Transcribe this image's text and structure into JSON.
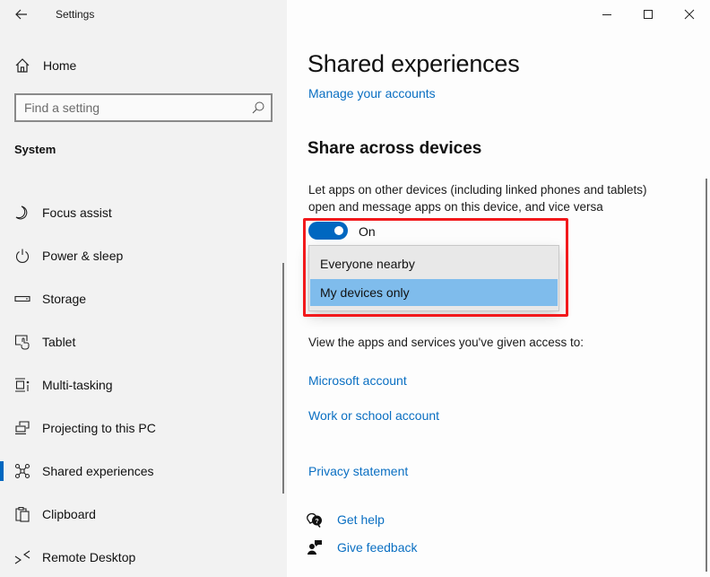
{
  "window": {
    "app_title": "Settings",
    "controls": {
      "minimize": "minimize-icon",
      "maximize": "maximize-icon",
      "close": "close-icon"
    }
  },
  "sidebar": {
    "back_icon": "back-arrow-icon",
    "home": {
      "label": "Home",
      "icon": "home-icon"
    },
    "search": {
      "placeholder": "Find a setting",
      "value": "",
      "icon": "search-icon"
    },
    "section_label": "System",
    "items": [
      {
        "label": "Focus assist",
        "icon": "moon-icon",
        "active": false
      },
      {
        "label": "Power & sleep",
        "icon": "power-icon",
        "active": false
      },
      {
        "label": "Storage",
        "icon": "storage-icon",
        "active": false
      },
      {
        "label": "Tablet",
        "icon": "tablet-icon",
        "active": false
      },
      {
        "label": "Multi-tasking",
        "icon": "multitasking-icon",
        "active": false
      },
      {
        "label": "Projecting to this PC",
        "icon": "projecting-icon",
        "active": false
      },
      {
        "label": "Shared experiences",
        "icon": "shared-experiences-icon",
        "active": true
      },
      {
        "label": "Clipboard",
        "icon": "clipboard-icon",
        "active": false
      },
      {
        "label": "Remote Desktop",
        "icon": "remote-desktop-icon",
        "active": false
      }
    ]
  },
  "main": {
    "title": "Shared experiences",
    "manage_accounts_link": "Manage your accounts",
    "section": {
      "heading": "Share across devices",
      "description": "Let apps on other devices (including linked phones and tablets) open and message apps on this device, and vice versa",
      "toggle": {
        "state": "On",
        "checked": true
      },
      "dropdown": {
        "options": [
          "Everyone nearby",
          "My devices only"
        ],
        "selected": "My devices only"
      }
    },
    "access_text": "View the apps and services you've given access to:",
    "access_links": [
      "Microsoft account",
      "Work or school account"
    ],
    "privacy_link": "Privacy statement",
    "help": [
      {
        "label": "Get help",
        "icon": "get-help-icon"
      },
      {
        "label": "Give feedback",
        "icon": "feedback-icon"
      }
    ]
  },
  "colors": {
    "accent": "#0067c0",
    "link": "#0a6fc2",
    "sidebar_bg": "#f2f2f2",
    "dropdown_bg": "#e8e8e8",
    "dropdown_selected": "#7fbcec",
    "highlight_border": "#f2191c"
  }
}
